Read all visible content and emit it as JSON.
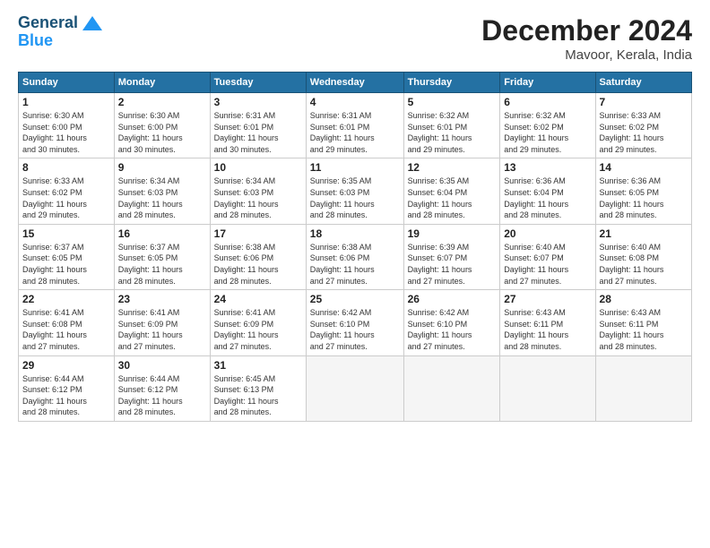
{
  "logo": {
    "line1": "General",
    "line2": "Blue"
  },
  "title": "December 2024",
  "subtitle": "Mavoor, Kerala, India",
  "days_of_week": [
    "Sunday",
    "Monday",
    "Tuesday",
    "Wednesday",
    "Thursday",
    "Friday",
    "Saturday"
  ],
  "weeks": [
    [
      {
        "day": 1,
        "info": "Sunrise: 6:30 AM\nSunset: 6:00 PM\nDaylight: 11 hours\nand 30 minutes."
      },
      {
        "day": 2,
        "info": "Sunrise: 6:30 AM\nSunset: 6:00 PM\nDaylight: 11 hours\nand 30 minutes."
      },
      {
        "day": 3,
        "info": "Sunrise: 6:31 AM\nSunset: 6:01 PM\nDaylight: 11 hours\nand 30 minutes."
      },
      {
        "day": 4,
        "info": "Sunrise: 6:31 AM\nSunset: 6:01 PM\nDaylight: 11 hours\nand 29 minutes."
      },
      {
        "day": 5,
        "info": "Sunrise: 6:32 AM\nSunset: 6:01 PM\nDaylight: 11 hours\nand 29 minutes."
      },
      {
        "day": 6,
        "info": "Sunrise: 6:32 AM\nSunset: 6:02 PM\nDaylight: 11 hours\nand 29 minutes."
      },
      {
        "day": 7,
        "info": "Sunrise: 6:33 AM\nSunset: 6:02 PM\nDaylight: 11 hours\nand 29 minutes."
      }
    ],
    [
      {
        "day": 8,
        "info": "Sunrise: 6:33 AM\nSunset: 6:02 PM\nDaylight: 11 hours\nand 29 minutes."
      },
      {
        "day": 9,
        "info": "Sunrise: 6:34 AM\nSunset: 6:03 PM\nDaylight: 11 hours\nand 28 minutes."
      },
      {
        "day": 10,
        "info": "Sunrise: 6:34 AM\nSunset: 6:03 PM\nDaylight: 11 hours\nand 28 minutes."
      },
      {
        "day": 11,
        "info": "Sunrise: 6:35 AM\nSunset: 6:03 PM\nDaylight: 11 hours\nand 28 minutes."
      },
      {
        "day": 12,
        "info": "Sunrise: 6:35 AM\nSunset: 6:04 PM\nDaylight: 11 hours\nand 28 minutes."
      },
      {
        "day": 13,
        "info": "Sunrise: 6:36 AM\nSunset: 6:04 PM\nDaylight: 11 hours\nand 28 minutes."
      },
      {
        "day": 14,
        "info": "Sunrise: 6:36 AM\nSunset: 6:05 PM\nDaylight: 11 hours\nand 28 minutes."
      }
    ],
    [
      {
        "day": 15,
        "info": "Sunrise: 6:37 AM\nSunset: 6:05 PM\nDaylight: 11 hours\nand 28 minutes."
      },
      {
        "day": 16,
        "info": "Sunrise: 6:37 AM\nSunset: 6:05 PM\nDaylight: 11 hours\nand 28 minutes."
      },
      {
        "day": 17,
        "info": "Sunrise: 6:38 AM\nSunset: 6:06 PM\nDaylight: 11 hours\nand 28 minutes."
      },
      {
        "day": 18,
        "info": "Sunrise: 6:38 AM\nSunset: 6:06 PM\nDaylight: 11 hours\nand 27 minutes."
      },
      {
        "day": 19,
        "info": "Sunrise: 6:39 AM\nSunset: 6:07 PM\nDaylight: 11 hours\nand 27 minutes."
      },
      {
        "day": 20,
        "info": "Sunrise: 6:40 AM\nSunset: 6:07 PM\nDaylight: 11 hours\nand 27 minutes."
      },
      {
        "day": 21,
        "info": "Sunrise: 6:40 AM\nSunset: 6:08 PM\nDaylight: 11 hours\nand 27 minutes."
      }
    ],
    [
      {
        "day": 22,
        "info": "Sunrise: 6:41 AM\nSunset: 6:08 PM\nDaylight: 11 hours\nand 27 minutes."
      },
      {
        "day": 23,
        "info": "Sunrise: 6:41 AM\nSunset: 6:09 PM\nDaylight: 11 hours\nand 27 minutes."
      },
      {
        "day": 24,
        "info": "Sunrise: 6:41 AM\nSunset: 6:09 PM\nDaylight: 11 hours\nand 27 minutes."
      },
      {
        "day": 25,
        "info": "Sunrise: 6:42 AM\nSunset: 6:10 PM\nDaylight: 11 hours\nand 27 minutes."
      },
      {
        "day": 26,
        "info": "Sunrise: 6:42 AM\nSunset: 6:10 PM\nDaylight: 11 hours\nand 27 minutes."
      },
      {
        "day": 27,
        "info": "Sunrise: 6:43 AM\nSunset: 6:11 PM\nDaylight: 11 hours\nand 28 minutes."
      },
      {
        "day": 28,
        "info": "Sunrise: 6:43 AM\nSunset: 6:11 PM\nDaylight: 11 hours\nand 28 minutes."
      }
    ],
    [
      {
        "day": 29,
        "info": "Sunrise: 6:44 AM\nSunset: 6:12 PM\nDaylight: 11 hours\nand 28 minutes."
      },
      {
        "day": 30,
        "info": "Sunrise: 6:44 AM\nSunset: 6:12 PM\nDaylight: 11 hours\nand 28 minutes."
      },
      {
        "day": 31,
        "info": "Sunrise: 6:45 AM\nSunset: 6:13 PM\nDaylight: 11 hours\nand 28 minutes."
      },
      null,
      null,
      null,
      null
    ]
  ]
}
